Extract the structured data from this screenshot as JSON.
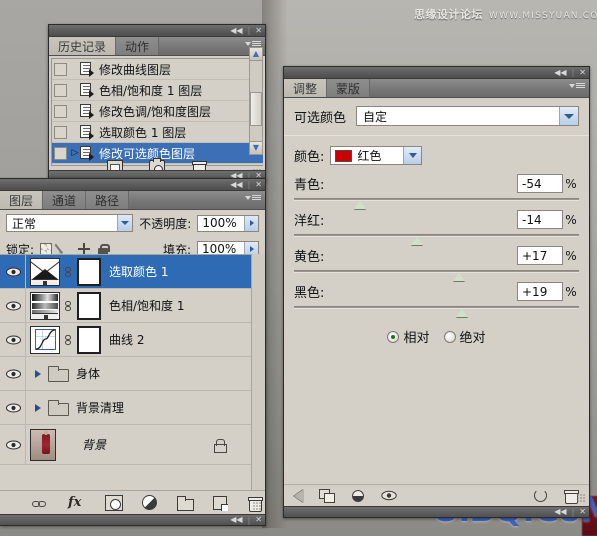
{
  "watermarks": {
    "top_cn": "思缘设计论坛",
    "top_url": "WWW.MISSYUAN.COM",
    "bottom": "UiBQ.CoM"
  },
  "history_panel": {
    "tabs": [
      {
        "label": "历史记录",
        "active": true
      },
      {
        "label": "动作",
        "active": false
      }
    ],
    "collapse_icon": "◀◀",
    "close_icon": "✕",
    "menu_icon": "panel-menu-icon",
    "items": [
      {
        "label": "修改曲线图层",
        "selected": false
      },
      {
        "label": "色相/饱和度 1 图层",
        "selected": false
      },
      {
        "label": "修改色调/饱和度图层",
        "selected": false
      },
      {
        "label": "选取颜色 1 图层",
        "selected": false
      },
      {
        "label": "修改可选颜色图层",
        "selected": true
      }
    ],
    "footer_icons": [
      "new-document-icon",
      "snapshot-camera-icon",
      "delete-trash-icon"
    ]
  },
  "layers_panel": {
    "tabs": [
      {
        "label": "图层",
        "active": true
      },
      {
        "label": "通道",
        "active": false
      },
      {
        "label": "路径",
        "active": false
      }
    ],
    "blend_mode": "正常",
    "opacity_label": "不透明度:",
    "opacity_value": "100%",
    "lock_label": "锁定:",
    "lock_icons": [
      "lock-transparency-icon",
      "lock-pixels-icon",
      "lock-position-icon",
      "lock-all-icon"
    ],
    "fill_label": "填充:",
    "fill_value": "100%",
    "layers": [
      {
        "name": "选取颜色 1",
        "kind": "selective-color",
        "selected": true,
        "visible": true,
        "has_mask": true,
        "italic": false,
        "locked": false
      },
      {
        "name": "色相/饱和度 1",
        "kind": "hue-saturation",
        "selected": false,
        "visible": true,
        "has_mask": true,
        "italic": false,
        "locked": false
      },
      {
        "name": "曲线 2",
        "kind": "curves",
        "selected": false,
        "visible": true,
        "has_mask": true,
        "italic": false,
        "locked": false
      },
      {
        "name": "身体",
        "kind": "group",
        "selected": false,
        "visible": true,
        "has_mask": false,
        "italic": false,
        "locked": false
      },
      {
        "name": "背景清理",
        "kind": "group",
        "selected": false,
        "visible": true,
        "has_mask": false,
        "italic": false,
        "locked": false
      },
      {
        "name": "背景",
        "kind": "photo",
        "selected": false,
        "visible": true,
        "has_mask": false,
        "italic": true,
        "locked": true
      }
    ],
    "footer_icons": [
      "link-layers-icon",
      "layer-style-fx-icon",
      "add-mask-icon",
      "new-adjustment-layer-icon",
      "new-group-icon",
      "new-layer-icon",
      "delete-layer-icon"
    ]
  },
  "adjustments_panel": {
    "tabs": [
      {
        "label": "调整",
        "active": true
      },
      {
        "label": "蒙版",
        "active": false
      }
    ],
    "title": "可选颜色",
    "preset_value": "自定",
    "color_label": "颜色:",
    "color_value": "红色",
    "color_swatch_hex": "#cc0000",
    "sliders": [
      {
        "label": "青色:",
        "value": "-54",
        "unit": "%",
        "percent": 23
      },
      {
        "label": "洋红:",
        "value": "-14",
        "unit": "%",
        "percent": 43
      },
      {
        "label": "黄色:",
        "value": "+17",
        "unit": "%",
        "percent": 58
      },
      {
        "label": "黑色:",
        "value": "+19",
        "unit": "%",
        "percent": 59
      }
    ],
    "method_options": [
      {
        "label": "相对",
        "selected": true
      },
      {
        "label": "绝对",
        "selected": false
      }
    ],
    "footer_icons": [
      "back-arrow-icon",
      "clip-to-layer-icon",
      "toggle-layer-view-icon",
      "eye-visibility-icon",
      "reset-icon",
      "delete-adjustment-icon"
    ]
  },
  "colors": {
    "panel_bg": "#d4d0c8",
    "selection_blue": "#2f6bb4",
    "history_selection_blue": "#3b6fb6",
    "slider_thumb": "#cfe0cb",
    "radio_on": "#2c6a2c",
    "watermark_blue": "#3f63c4"
  }
}
